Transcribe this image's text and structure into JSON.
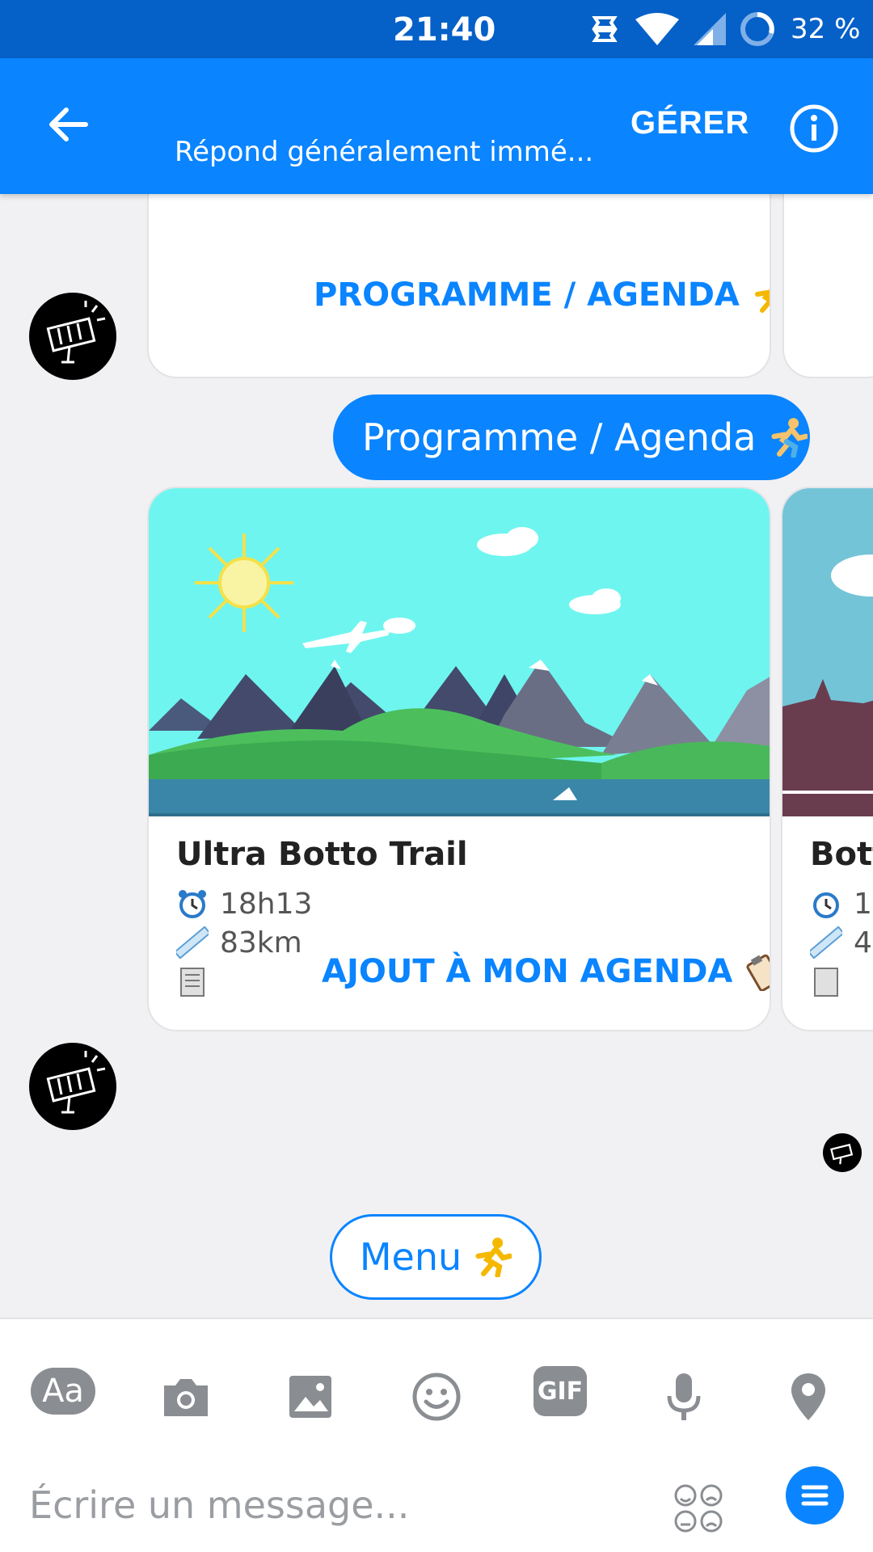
{
  "status_bar": {
    "time": "21:40",
    "battery": "32 %"
  },
  "header": {
    "subtitle": "Répond généralement immé...",
    "manage_label": "GÉRER"
  },
  "chat": {
    "prev_card_button": "PROGRAMME / AGENDA",
    "my_message": "Programme / Agenda",
    "event_card": {
      "title": "Ultra Botto Trail",
      "time": "18h13",
      "distance": "83km",
      "button": "AJOUT À MON AGENDA"
    },
    "next_card": {
      "title_partial": "Bott",
      "time_partial": "1",
      "distance_partial": "4"
    },
    "menu_button": "Menu"
  },
  "composer": {
    "aa_label": "Aa",
    "gif_label": "GIF",
    "placeholder": "Écrire un message..."
  },
  "colors": {
    "accent": "#0a84ff",
    "status_bar": "#0560c8",
    "background": "#f1f1f3"
  },
  "icons": [
    "back-arrow-icon",
    "info-icon",
    "runner-icon",
    "alarm-clock-icon",
    "ruler-icon",
    "newspaper-icon",
    "clipboard-icon",
    "camera-icon",
    "image-icon",
    "smiley-icon",
    "microphone-icon",
    "location-pin-icon",
    "emoji-faces-icon",
    "menu-lines-icon"
  ]
}
